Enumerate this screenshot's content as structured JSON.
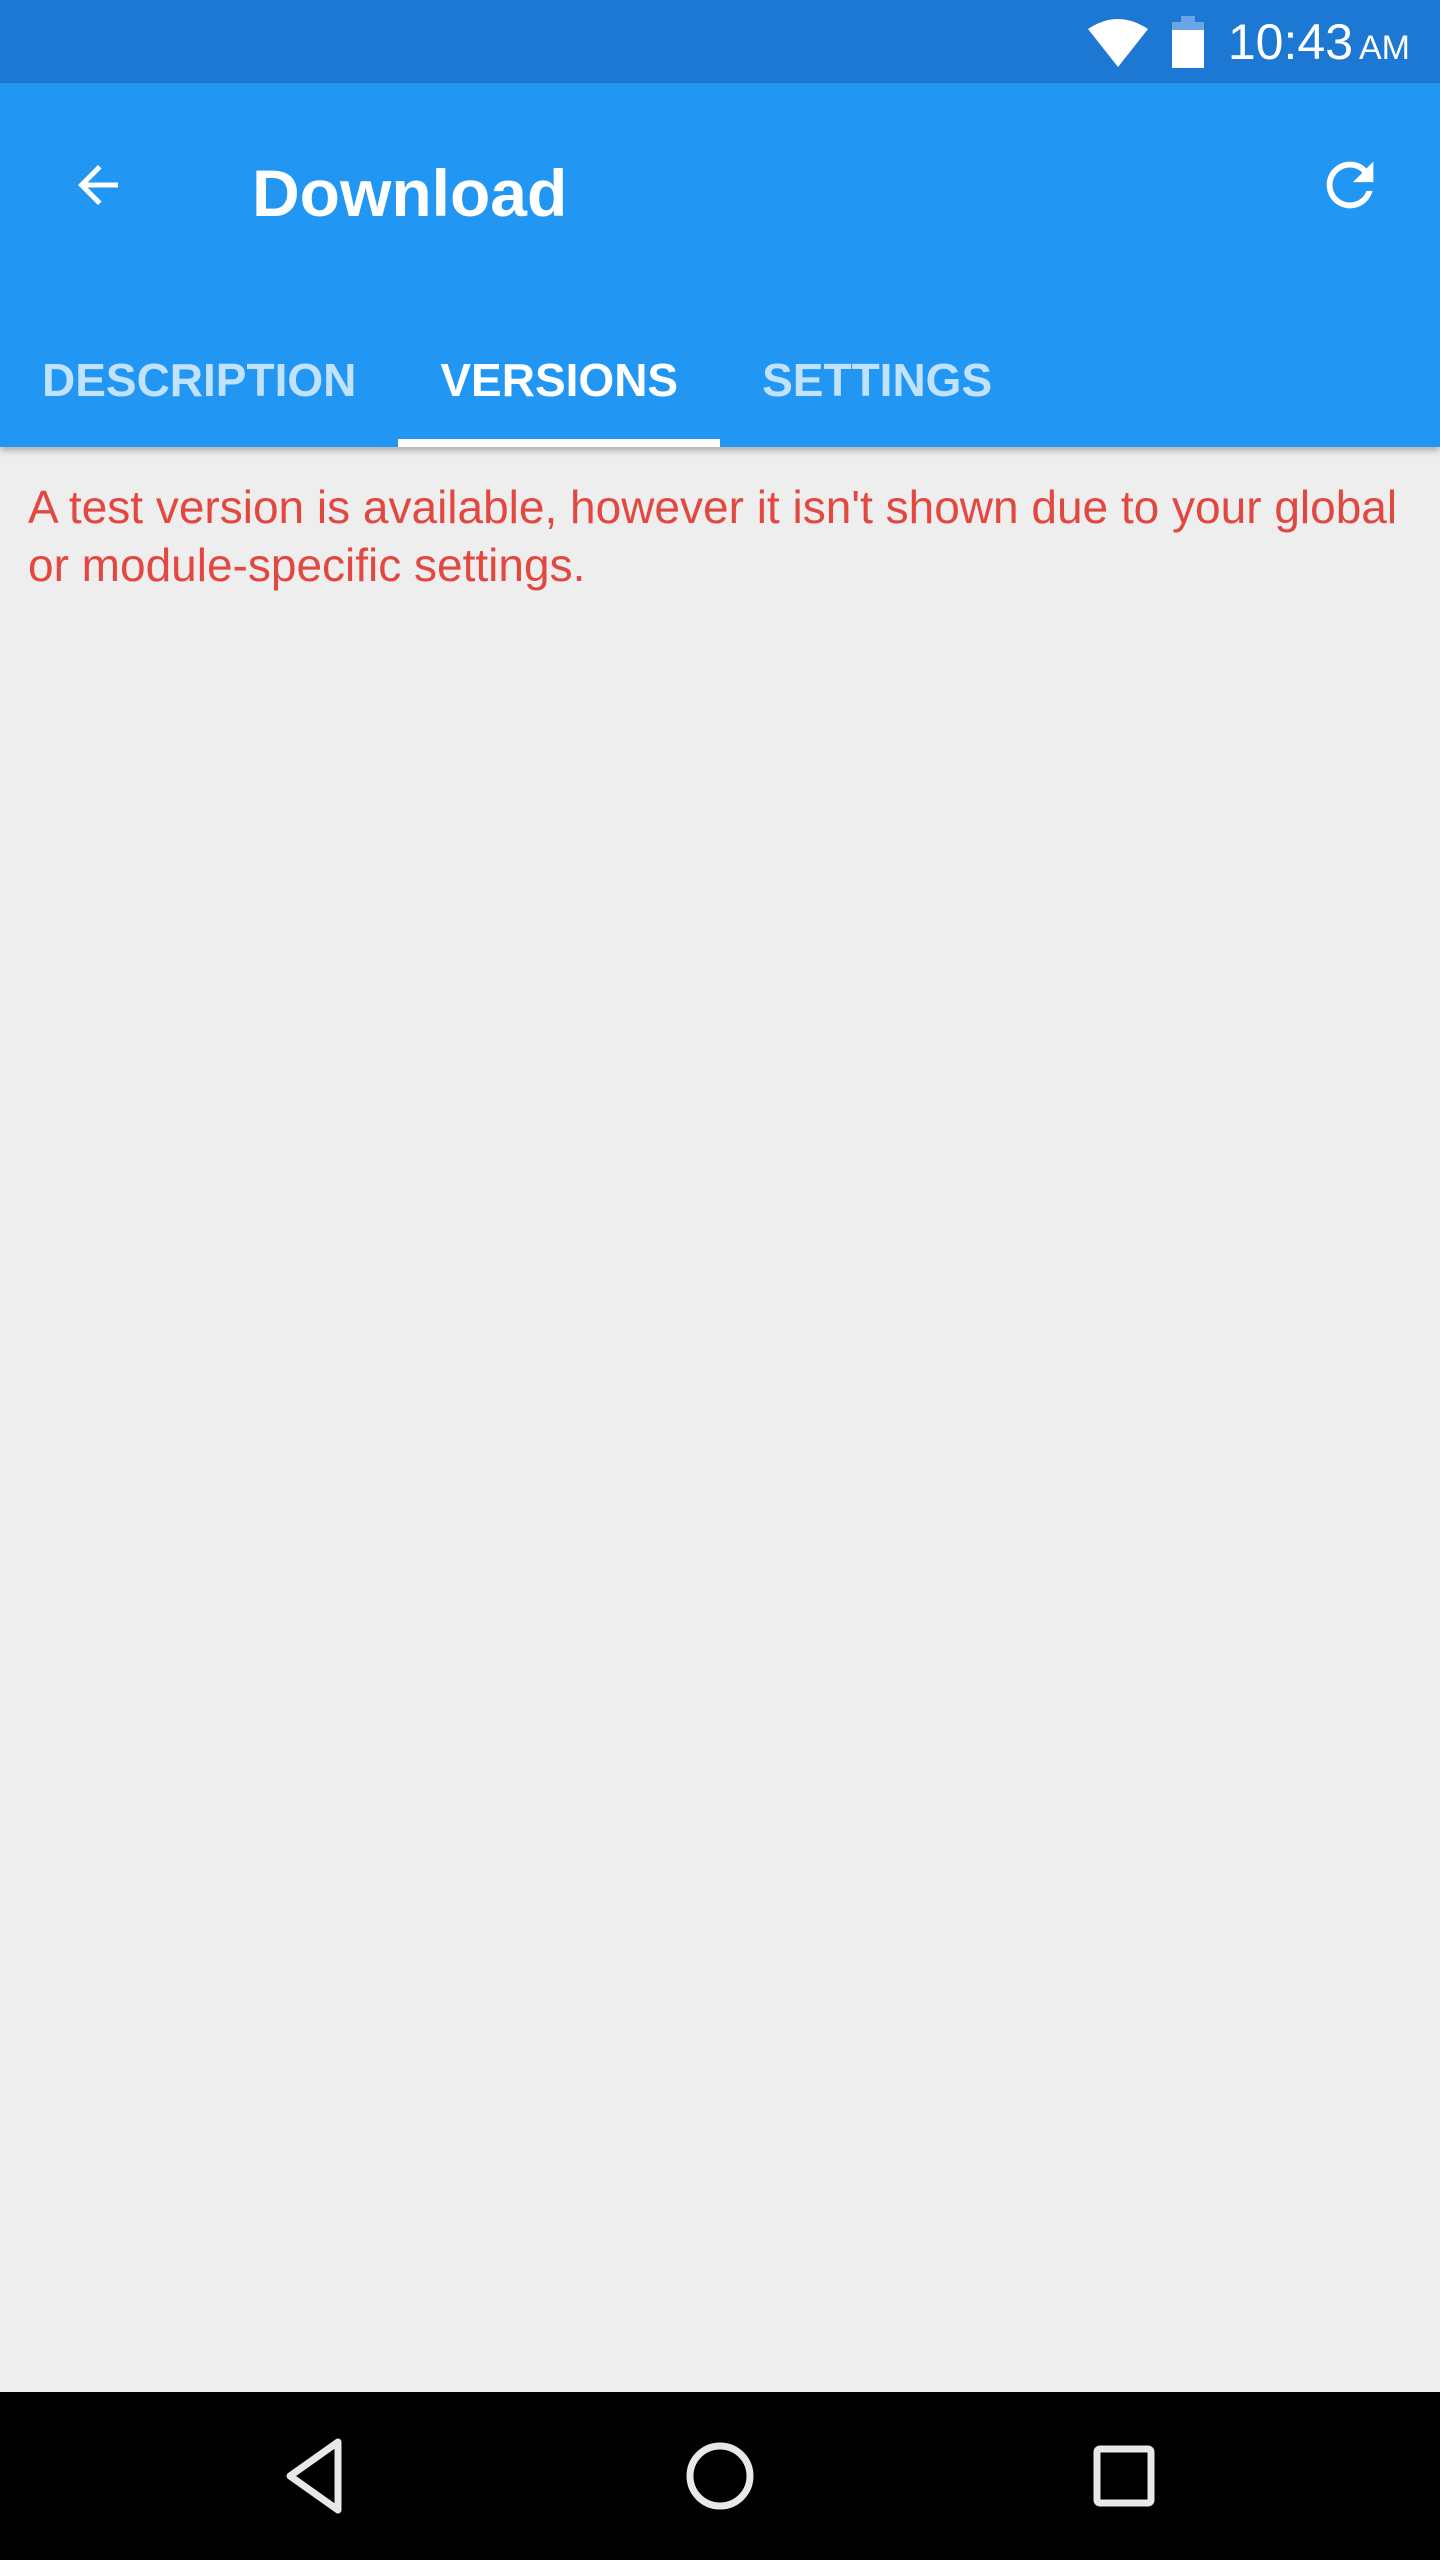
{
  "status_bar": {
    "time": "10:43",
    "ampm": "AM",
    "icons": [
      "wifi-icon",
      "battery-icon"
    ]
  },
  "app_bar": {
    "title": "Download",
    "back_icon": "arrow-back-icon",
    "refresh_icon": "refresh-icon"
  },
  "tabs": [
    {
      "label": "DESCRIPTION",
      "active": false
    },
    {
      "label": "VERSIONS",
      "active": true
    },
    {
      "label": "SETTINGS",
      "active": false
    }
  ],
  "content": {
    "message": "A test version is available, however it isn't shown due to your global or module-specific settings."
  },
  "nav_bar": {
    "buttons": [
      "back",
      "home",
      "recents"
    ]
  },
  "colors": {
    "status_bar": "#1c78d3",
    "app_bar": "#2196f3",
    "message_text": "#e2483f",
    "background": "#eeeeee"
  }
}
